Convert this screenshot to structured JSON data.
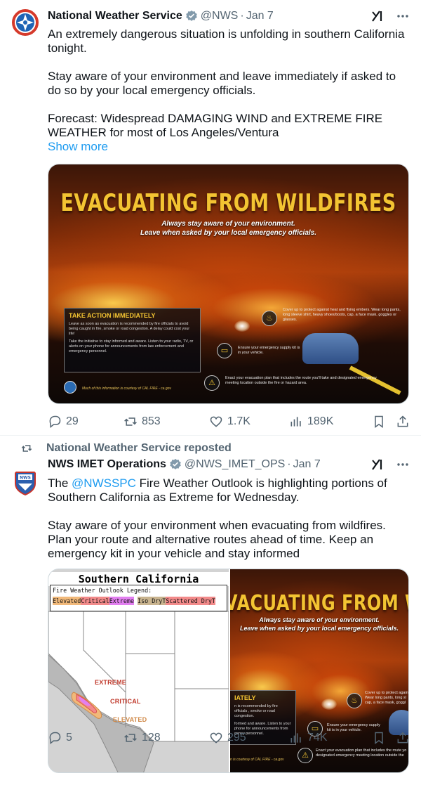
{
  "tweet1": {
    "author_name": "National Weather Service",
    "author_handle": "@NWS",
    "separator": "·",
    "date": "Jan 7",
    "text_1": "An extremely dangerous situation is unfolding in southern California tonight.",
    "text_2": "Stay aware of your environment and leave immediately if asked to do so by your local emergency officials.",
    "text_3": "Forecast: Widespread DAMAGING WIND and EXTREME FIRE WEATHER for most of Los Angeles/Ventura",
    "show_more": "Show more",
    "image": {
      "title": "EVACUATING FROM WILDFIRES",
      "subtitle_1": "Always stay aware of your environment.",
      "subtitle_2": "Leave when asked by your local emergency officials.",
      "take_title": "TAKE ACTION IMMEDIATELY",
      "take_p1": "Leave as soon as evacuation is recommended by fire officials to avoid being caught in fire, smoke or road congestion. A delay could cost your life!",
      "take_p2": "Take the initiative to stay informed and aware. Listen to your radio, TV, or alerts on your phone for announcements from law enforcement and emergency personnel.",
      "tip_1": "Cover up to protect against heat and flying embers. Wear long pants, long sleeve shirt, heavy shoes/boots, cap, a face mask, goggles or glasses.",
      "tip_2": "Ensure your emergency supply kit is in your vehicle.",
      "tip_3": "Enact your evacuation plan that includes the route you'll take and designated emergency meeting location outside the fire or hazard area.",
      "credit": "Much of this information is courtesy of CAL FIRE - ca.gov"
    },
    "stats": {
      "replies": "29",
      "reposts": "853",
      "likes": "1.7K",
      "views": "189K"
    }
  },
  "tweet2": {
    "repost_label": "National Weather Service reposted",
    "author_name": "NWS IMET Operations",
    "author_handle": "@NWS_IMET_OPS",
    "separator": "·",
    "date": "Jan 7",
    "text_mention": "@NWSSPC",
    "text_1_rest": " Fire Weather Outlook is highlighting portions of Southern California as Extreme for Wednesday.",
    "text_1_prefix": "The ",
    "text_2": "Stay aware of your environment when evacuating from wildfires. Plan your route and alternative routes ahead of time. Keep an emergency kit in your vehicle and stay informed",
    "map": {
      "title": "Southern California",
      "legend_title": "Fire Weather Outlook Legend:",
      "legend": [
        "Elevated",
        "Critical",
        "Extreme",
        "Iso DryT",
        "Scattered DryT"
      ],
      "legend_colors": [
        "#f1b97a",
        "#f28a8a",
        "#e27ff0",
        "#c9b48f",
        "#f28a8a"
      ],
      "label_extreme": "EXTREME",
      "label_critical": "CRITICAL",
      "label_elevated": "ELEVATED"
    },
    "image": {
      "title": "VACUATING FROM WILDFIRE",
      "subtitle_1": "Always stay aware of your environment.",
      "subtitle_2": "Leave when asked by your local emergency officials.",
      "take_title": "IATELY",
      "take_p1": "n is recommended by fire officials , smoke or road congestion.",
      "take_p2": "formed and aware. Listen to your phone for announcements from gency personnel.",
      "tip_1": "Cover up to protect again Wear long pants, long sl cap, a face mask, goggl",
      "tip_2": "Ensure your emergency supply kit is in your vehicle.",
      "tip_3": "Enact your evacuation plan that includes the route yo designated emergency meeting location outside the",
      "credit": "n is courtesy of CAL FIRE - ca.gov"
    },
    "stats": {
      "replies": "5",
      "reposts": "128",
      "likes": "295",
      "views": "74K"
    }
  }
}
